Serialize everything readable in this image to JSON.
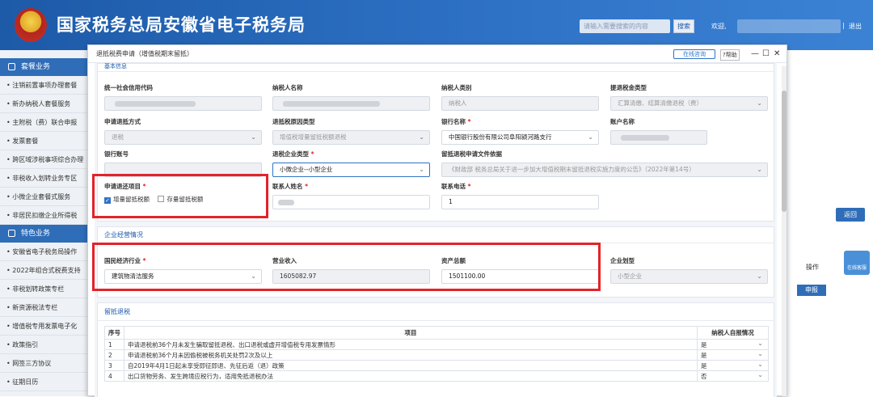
{
  "header": {
    "title": "国家税务总局安徽省电子税务局",
    "search_placeholder": "请输入需要搜索的内容",
    "search_button": "搜索",
    "welcome": "欢迎,",
    "separator": "|",
    "exit": "退出"
  },
  "sidebar": {
    "group1": "套餐业务",
    "items1": [
      "注销前置事项办理套餐",
      "新办纳税人套餐服务",
      "主附税（费）联合申报",
      "发票套餐",
      "跨区域涉税事项综合办理",
      "非税收入划转业务专区",
      "小微企业套餐式服务",
      "非居民扣缴企业所得税"
    ],
    "group2": "特色业务",
    "items2": [
      "安徽省电子税务局操作",
      "2022年组合式税费支持",
      "非税划转政策专栏",
      "新资源税法专栏",
      "增值税专用发票电子化",
      "政策指引",
      "网签三方协议",
      "征期日历"
    ]
  },
  "right_panel": {
    "back_button": "返回",
    "op_header": "操作",
    "report_button": "申报",
    "cs_label": "在线客服"
  },
  "modal": {
    "title": "退抵税费申请（增值税期末留抵）",
    "online_btn": "在线咨询",
    "help_btn": "?帮助",
    "min_icon": "—",
    "max_icon": "☐",
    "close_icon": "✕",
    "basic_section": "基本信息",
    "fields": {
      "credit_code_label": "统一社会信用代码",
      "credit_code_value": "",
      "taxpayer_name_label": "纳税人名称",
      "taxpayer_type_label": "纳税人类别",
      "taxpayer_type_value": "纳税人",
      "refund_type_label": "提退税金类型",
      "refund_type_value": "汇算清缴、结算清缴退税（费）",
      "refund_method_label": "申请退抵方式",
      "refund_method_value": "退税",
      "reason_label": "退抵税原因类型",
      "reason_value": "增值税增量留抵税额退税",
      "bank_name_label": "银行名称",
      "bank_name_value": "中国银行股份有限公司阜阳颍河路支行",
      "account_name_label": "账户名称",
      "bank_account_label": "银行账号",
      "enterprise_type_label": "退税企业类型",
      "enterprise_type_value": "小微企业--小型企业",
      "policy_basis_label": "留抵退税申请文件依据",
      "policy_basis_value": "《财政部 税务总局关于进一步加大增值税期末留抵退税实施力度的公告》（2022年第14号）",
      "items_label": "申请退还项目",
      "item1": "增量留抵税额",
      "item2": "存量留抵税额",
      "contact_label": "联系人姓名",
      "phone_label": "联系电话",
      "phone_value": "1"
    },
    "operation_section": "企业经营情况",
    "operation": {
      "industry_label": "国民经济行业",
      "industry_value": "建筑物清洁服务",
      "revenue_label": "营业收入",
      "revenue_value": "1605082.97",
      "assets_label": "资产总额",
      "assets_value": "1501100.00",
      "scale_label": "企业划型",
      "scale_value": "小型企业"
    },
    "refund_section": "留抵退税",
    "table": {
      "col_no": "序号",
      "col_item": "项目",
      "col_check": "纳税人自报情况",
      "rows": [
        {
          "no": "1",
          "item": "申请退税前36个月未发生骗取留抵退税、出口退税或虚开增值税专用发票情形",
          "val": "是"
        },
        {
          "no": "2",
          "item": "申请退税前36个月未因偷税被税务机关处罚2次及以上",
          "val": "是"
        },
        {
          "no": "3",
          "item": "自2019年4月1日起未享受即征即退、先征后返（退）政策",
          "val": "是"
        },
        {
          "no": "4",
          "item": "出口货物劳务、发生跨境应税行为，适用免抵退税办法",
          "val": "否"
        }
      ]
    }
  },
  "required_mark": "*",
  "checkmark": "✓",
  "chevron": "⌄"
}
